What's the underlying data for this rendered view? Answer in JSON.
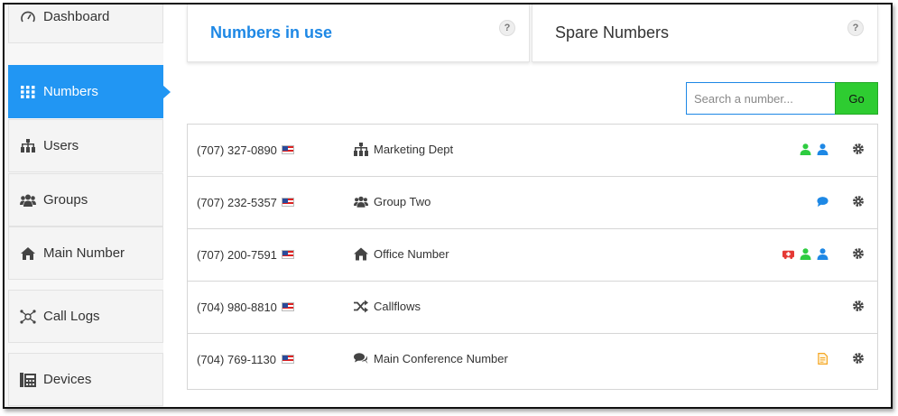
{
  "sidebar": {
    "items": [
      {
        "label": "Dashboard",
        "icon": "dashboard-icon"
      },
      {
        "label": "Numbers",
        "icon": "grid-icon",
        "active": true
      },
      {
        "label": "Users",
        "icon": "users-org-icon"
      },
      {
        "label": "Groups",
        "icon": "group-icon"
      },
      {
        "label": "Main Number",
        "icon": "home-icon"
      },
      {
        "label": "Call Logs",
        "icon": "call-logs-icon"
      },
      {
        "label": "Devices",
        "icon": "devices-icon"
      }
    ]
  },
  "tabs": [
    {
      "label": "Numbers in use",
      "help": "?"
    },
    {
      "label": "Spare Numbers",
      "help": "?"
    }
  ],
  "search": {
    "placeholder": "Search a number...",
    "button": "Go"
  },
  "numbers": [
    {
      "number": "(707) 327-0890",
      "name": "Marketing Dept",
      "icon": "users-org-icon",
      "badges": [
        "user-green-icon",
        "user-blue-icon"
      ]
    },
    {
      "number": "(707) 232-5357",
      "name": "Group Two",
      "icon": "group-icon",
      "badges": [
        "chat-blue-icon"
      ]
    },
    {
      "number": "(707) 200-7591",
      "name": "Office Number",
      "icon": "home-icon",
      "badges": [
        "medical-red-icon",
        "user-green-icon",
        "user-blue-icon"
      ]
    },
    {
      "number": "(704) 980-8810",
      "name": "Callflows",
      "icon": "shuffle-icon",
      "badges": []
    },
    {
      "number": "(704) 769-1130",
      "name": "Main Conference Number",
      "icon": "comments-icon",
      "badges": [
        "document-orange-icon"
      ]
    }
  ],
  "colors": {
    "accent": "#2196f3",
    "go": "#2ecc31",
    "green": "#2ecc40",
    "blue": "#1e88e5",
    "red": "#e53935",
    "orange": "#f5a623"
  }
}
